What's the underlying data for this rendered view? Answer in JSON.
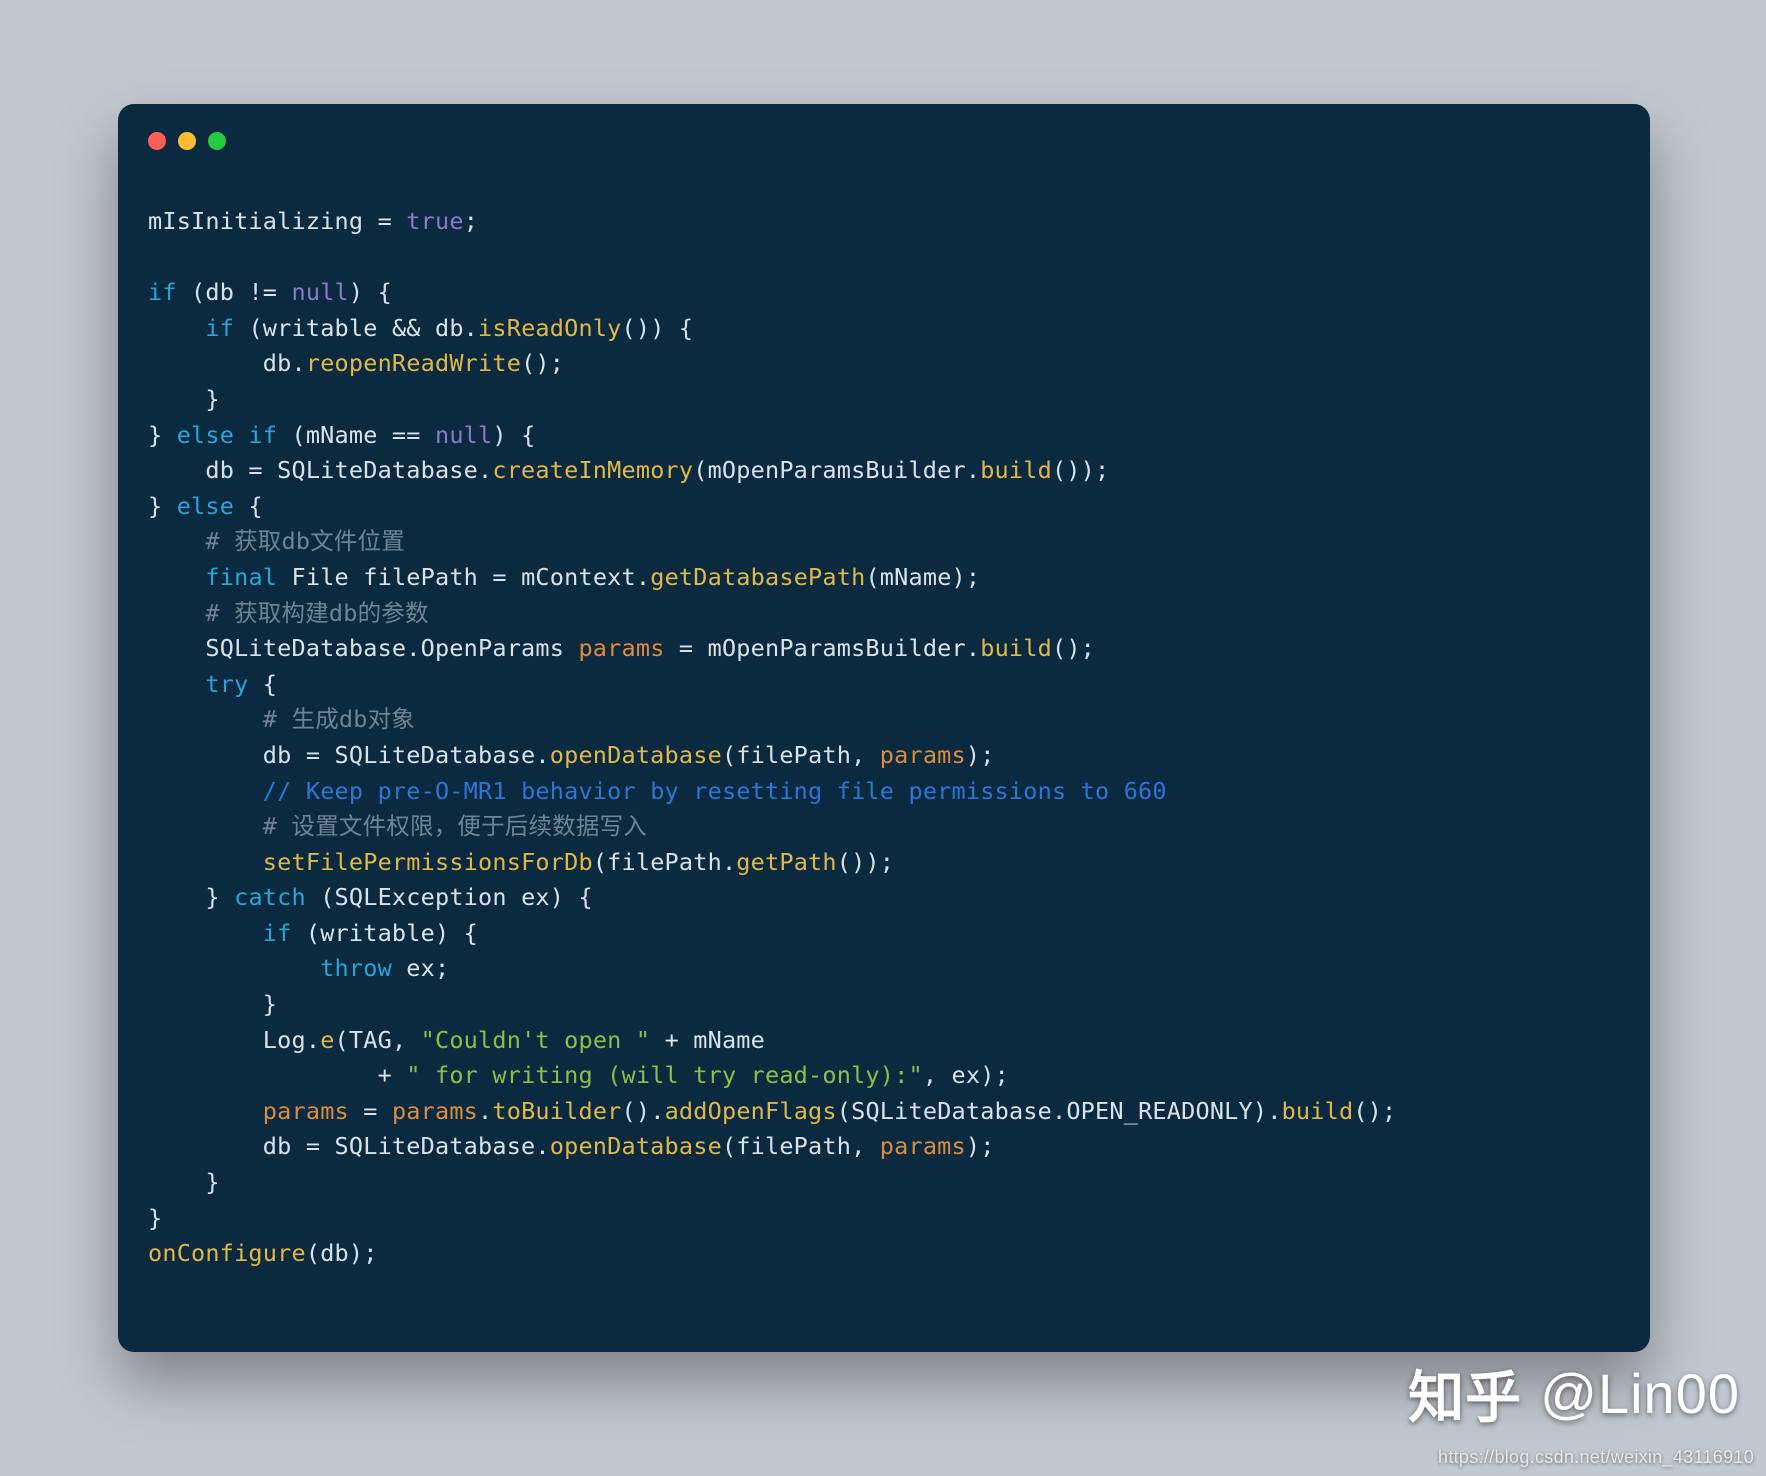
{
  "colors": {
    "background": "#c2c8d0",
    "window": "#0c2a3f",
    "dots": {
      "red": "#ff5f56",
      "yellow": "#ffbd2e",
      "green": "#27c93f"
    },
    "keyword": "#29a4d8",
    "null_true": "#8b79c7",
    "default": "#d9e2e8",
    "method": "#e0b84a",
    "variable": "#db8c3e",
    "string": "#8cbf4a",
    "line_comment": "#2c75d6",
    "hash_comment": "#6f8492"
  },
  "watermark": {
    "logo": "知乎",
    "author": "@Lin00",
    "url": "https://blog.csdn.net/weixin_43116910"
  },
  "code": {
    "lines": [
      [
        {
          "c": "id",
          "t": "mIsInitializing = "
        },
        {
          "c": "nul",
          "t": "true"
        },
        {
          "c": "id",
          "t": ";"
        }
      ],
      [],
      [
        {
          "c": "kw",
          "t": "if"
        },
        {
          "c": "id",
          "t": " (db != "
        },
        {
          "c": "nul",
          "t": "null"
        },
        {
          "c": "id",
          "t": ") {"
        }
      ],
      [
        {
          "c": "id",
          "t": "    "
        },
        {
          "c": "kw",
          "t": "if"
        },
        {
          "c": "id",
          "t": " (writable && db."
        },
        {
          "c": "fn",
          "t": "isReadOnly"
        },
        {
          "c": "id",
          "t": "()) {"
        }
      ],
      [
        {
          "c": "id",
          "t": "        db."
        },
        {
          "c": "fn",
          "t": "reopenReadWrite"
        },
        {
          "c": "id",
          "t": "();"
        }
      ],
      [
        {
          "c": "id",
          "t": "    }"
        }
      ],
      [
        {
          "c": "id",
          "t": "} "
        },
        {
          "c": "kw",
          "t": "else if"
        },
        {
          "c": "id",
          "t": " (mName == "
        },
        {
          "c": "nul",
          "t": "null"
        },
        {
          "c": "id",
          "t": ") {"
        }
      ],
      [
        {
          "c": "id",
          "t": "    db = SQLiteDatabase."
        },
        {
          "c": "fn",
          "t": "createInMemory"
        },
        {
          "c": "id",
          "t": "(mOpenParamsBuilder."
        },
        {
          "c": "fn",
          "t": "build"
        },
        {
          "c": "id",
          "t": "());"
        }
      ],
      [
        {
          "c": "id",
          "t": "} "
        },
        {
          "c": "kw",
          "t": "else"
        },
        {
          "c": "id",
          "t": " {"
        }
      ],
      [
        {
          "c": "id",
          "t": "    "
        },
        {
          "c": "hash",
          "t": "# 获取db文件位置"
        }
      ],
      [
        {
          "c": "id",
          "t": "    "
        },
        {
          "c": "kw",
          "t": "final"
        },
        {
          "c": "id",
          "t": " File filePath = mContext."
        },
        {
          "c": "fn",
          "t": "getDatabasePath"
        },
        {
          "c": "id",
          "t": "(mName);"
        }
      ],
      [
        {
          "c": "id",
          "t": "    "
        },
        {
          "c": "hash",
          "t": "# 获取构建db的参数"
        }
      ],
      [
        {
          "c": "id",
          "t": "    SQLiteDatabase.OpenParams "
        },
        {
          "c": "var",
          "t": "params"
        },
        {
          "c": "id",
          "t": " = mOpenParamsBuilder."
        },
        {
          "c": "fn",
          "t": "build"
        },
        {
          "c": "id",
          "t": "();"
        }
      ],
      [
        {
          "c": "id",
          "t": "    "
        },
        {
          "c": "kw",
          "t": "try"
        },
        {
          "c": "id",
          "t": " {"
        }
      ],
      [
        {
          "c": "id",
          "t": "        "
        },
        {
          "c": "hash",
          "t": "# 生成db对象"
        }
      ],
      [
        {
          "c": "id",
          "t": "        db = SQLiteDatabase."
        },
        {
          "c": "fn",
          "t": "openDatabase"
        },
        {
          "c": "id",
          "t": "(filePath, "
        },
        {
          "c": "var",
          "t": "params"
        },
        {
          "c": "id",
          "t": ");"
        }
      ],
      [
        {
          "c": "id",
          "t": "        "
        },
        {
          "c": "cmt",
          "t": "// Keep pre-O-MR1 behavior by resetting file permissions to 660"
        }
      ],
      [
        {
          "c": "id",
          "t": "        "
        },
        {
          "c": "hash",
          "t": "# 设置文件权限，便于后续数据写入"
        }
      ],
      [
        {
          "c": "id",
          "t": "        "
        },
        {
          "c": "fn",
          "t": "setFilePermissionsForDb"
        },
        {
          "c": "id",
          "t": "(filePath."
        },
        {
          "c": "fn",
          "t": "getPath"
        },
        {
          "c": "id",
          "t": "());"
        }
      ],
      [
        {
          "c": "id",
          "t": "    } "
        },
        {
          "c": "kw",
          "t": "catch"
        },
        {
          "c": "id",
          "t": " (SQLException ex) {"
        }
      ],
      [
        {
          "c": "id",
          "t": "        "
        },
        {
          "c": "kw",
          "t": "if"
        },
        {
          "c": "id",
          "t": " (writable) {"
        }
      ],
      [
        {
          "c": "id",
          "t": "            "
        },
        {
          "c": "kw",
          "t": "throw"
        },
        {
          "c": "id",
          "t": " ex;"
        }
      ],
      [
        {
          "c": "id",
          "t": "        }"
        }
      ],
      [
        {
          "c": "id",
          "t": "        Log."
        },
        {
          "c": "fn",
          "t": "e"
        },
        {
          "c": "id",
          "t": "(TAG, "
        },
        {
          "c": "str",
          "t": "\"Couldn't open \""
        },
        {
          "c": "id",
          "t": " + mName"
        }
      ],
      [
        {
          "c": "id",
          "t": "                + "
        },
        {
          "c": "str",
          "t": "\" for writing (will try read-only):\""
        },
        {
          "c": "id",
          "t": ", ex);"
        }
      ],
      [
        {
          "c": "id",
          "t": "        "
        },
        {
          "c": "var",
          "t": "params"
        },
        {
          "c": "id",
          "t": " = "
        },
        {
          "c": "var",
          "t": "params"
        },
        {
          "c": "id",
          "t": "."
        },
        {
          "c": "fn",
          "t": "toBuilder"
        },
        {
          "c": "id",
          "t": "()."
        },
        {
          "c": "fn",
          "t": "addOpenFlags"
        },
        {
          "c": "id",
          "t": "(SQLiteDatabase.OPEN_READONLY)."
        },
        {
          "c": "fn",
          "t": "build"
        },
        {
          "c": "id",
          "t": "();"
        }
      ],
      [
        {
          "c": "id",
          "t": "        db = SQLiteDatabase."
        },
        {
          "c": "fn",
          "t": "openDatabase"
        },
        {
          "c": "id",
          "t": "(filePath, "
        },
        {
          "c": "var",
          "t": "params"
        },
        {
          "c": "id",
          "t": ");"
        }
      ],
      [
        {
          "c": "id",
          "t": "    }"
        }
      ],
      [
        {
          "c": "id",
          "t": "}"
        }
      ],
      [
        {
          "c": "fn",
          "t": "onConfigure"
        },
        {
          "c": "id",
          "t": "(db);"
        }
      ]
    ]
  }
}
